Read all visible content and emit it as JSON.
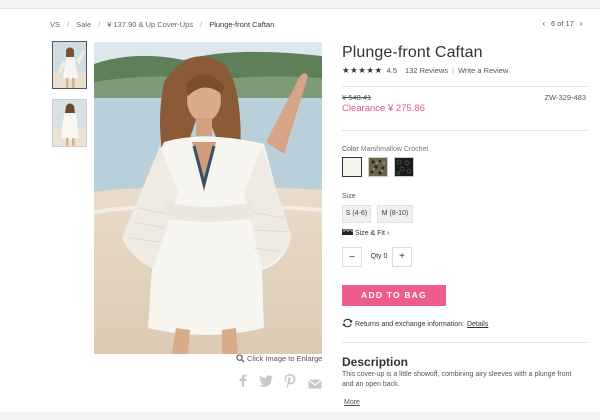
{
  "breadcrumb": {
    "items": [
      "VS",
      "Sale",
      "¥ 137.90 & Up Cover-Ups",
      "Plunge-front Caftan"
    ],
    "separator": "/"
  },
  "pager": {
    "prev_icon": "chevron-left-icon",
    "text": "6 of 17",
    "next_icon": "chevron-right-icon"
  },
  "gallery": {
    "thumbnails": 2,
    "zoom_label": "Click Image to Enlarge"
  },
  "share_icons": [
    "facebook-icon",
    "twitter-icon",
    "pinterest-icon",
    "email-icon"
  ],
  "product": {
    "title": "Plunge-front Caftan",
    "rating": {
      "value": "4.5",
      "stars": 4.5,
      "stars_text": "★★★★★"
    },
    "reviews": "132 Reviews",
    "write_review": "Write a Review",
    "was_price": "¥ 548.41",
    "sale_price": "Clearance ¥ 275.86",
    "sku": "ZW-329-483",
    "color_label": "Color",
    "color_value": "Marshmallow Crochet",
    "swatches": [
      {
        "name": "Marshmallow Crochet",
        "color": "#f6f4ee",
        "selected": true
      },
      {
        "name": "Leopard",
        "color": "#55503e",
        "selected": false
      },
      {
        "name": "Black Crochet",
        "color": "#1c1c1c",
        "selected": false
      }
    ],
    "size_label": "Size",
    "sizes": [
      "S (4-6)",
      "M (8-10)"
    ],
    "size_fit": "Size & Fit ›",
    "qty_minus": "–",
    "qty_label": "Qty 0",
    "qty_plus": "+",
    "add_to_bag": "ADD TO BAG",
    "returns_text": "Returns and exchange information:",
    "returns_link": "Details",
    "description_heading": "Description",
    "description": "This cover-up is a little showoff, combining airy sleeves with a plunge front and an open back.",
    "more": "More"
  },
  "colors": {
    "accent": "#ee5c8c",
    "sale": "#e7557f"
  }
}
